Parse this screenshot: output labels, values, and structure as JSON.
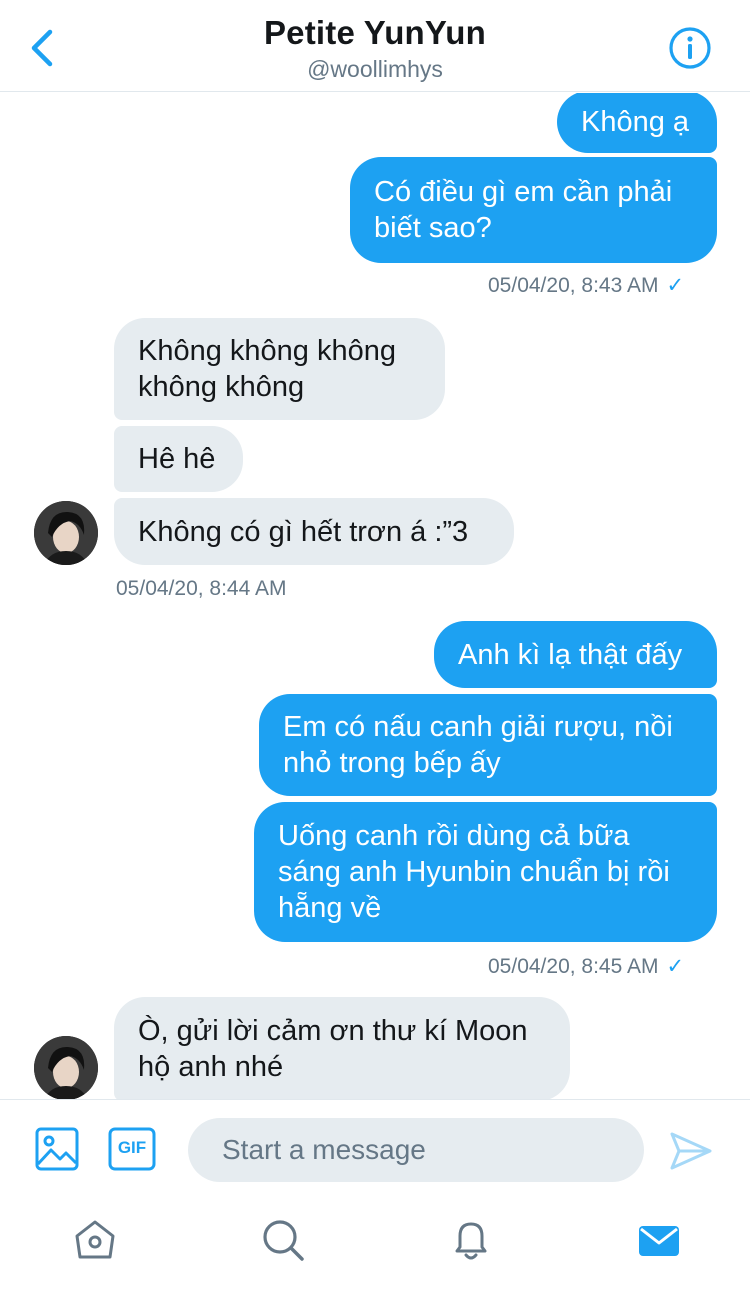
{
  "header": {
    "title": "Petite YunYun",
    "handle": "@woollimhys"
  },
  "messages": [
    {
      "id": 1,
      "direction": "sent",
      "lines": [
        "Không ạ"
      ]
    },
    {
      "id": 2,
      "direction": "sent",
      "lines": [
        "Có điều gì em cần phải",
        "biết sao?"
      ]
    },
    {
      "id": 3,
      "direction": "recv",
      "lines": [
        "Không không không",
        "không không"
      ]
    },
    {
      "id": 4,
      "direction": "recv",
      "lines": [
        "Hê hê"
      ]
    },
    {
      "id": 5,
      "direction": "recv",
      "lines": [
        "Không có gì hết trơn á :”3"
      ]
    },
    {
      "id": 6,
      "direction": "sent",
      "lines": [
        "Anh kì lạ thật đấy"
      ]
    },
    {
      "id": 7,
      "direction": "sent",
      "lines": [
        "Em có nấu canh giải rượu, nồi",
        "nhỏ trong bếp ấy"
      ]
    },
    {
      "id": 8,
      "direction": "sent",
      "lines": [
        "Uống canh rồi dùng cả bữa",
        "sáng anh Hyunbin chuẩn bị rồi",
        "hẵng về"
      ]
    },
    {
      "id": 9,
      "direction": "recv",
      "lines": [
        "Ò, gửi lời cảm ơn thư kí Moon",
        "hộ anh nhé"
      ]
    }
  ],
  "timestamps": {
    "t1": "05/04/20, 8:43 AM",
    "t2": "05/04/20, 8:44 AM",
    "t3": "05/04/20, 8:45 AM",
    "check": "✓"
  },
  "composer": {
    "placeholder": "Start a message",
    "gif_label": "GIF"
  },
  "colors": {
    "accent": "#1da1f2",
    "received_bubble": "#e6ecf0",
    "secondary_text": "#657786"
  },
  "icons": [
    "back-chevron-icon",
    "info-icon",
    "image-icon",
    "gif-icon",
    "send-icon",
    "home-icon",
    "search-icon",
    "notifications-bell-icon",
    "messages-mail-icon"
  ]
}
